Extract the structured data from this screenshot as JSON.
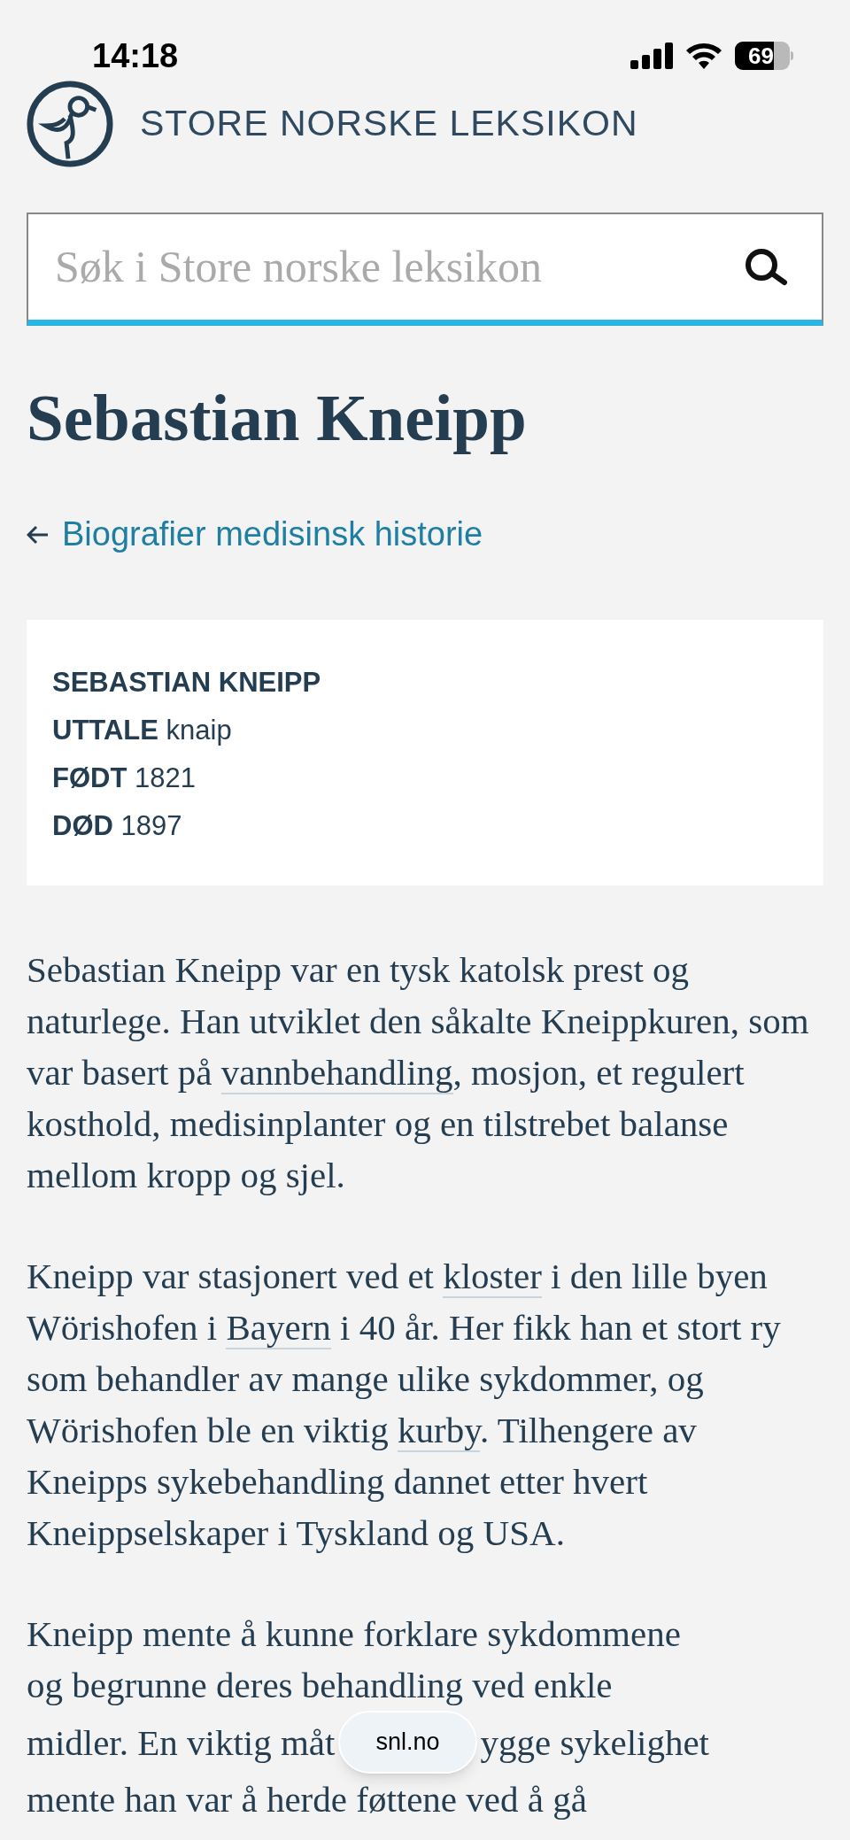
{
  "status_bar": {
    "time": "14:18",
    "battery": "69"
  },
  "header": {
    "site_name": "STORE NORSKE LEKSIKON"
  },
  "search": {
    "placeholder": "Søk i Store norske leksikon"
  },
  "article": {
    "title": "Sebastian Kneipp",
    "back_link": "Biografier medisinsk historie",
    "infobox": [
      {
        "label": "SEBASTIAN KNEIPP"
      },
      {
        "label": "UTTALE",
        "value": "knaip"
      },
      {
        "label": "FØDT",
        "value": "1821"
      },
      {
        "label": "DØD",
        "value": "1897"
      }
    ],
    "paragraphs": [
      {
        "segments": [
          {
            "text": "Sebastian Kneipp var en tysk katolsk prest og naturlege. Han utviklet den såkalte Kneippkuren, som var basert på ",
            "link": false
          },
          {
            "text": "vannbehandling",
            "link": true
          },
          {
            "text": ", mosjon, et regulert kosthold, medisinplanter og en tilstrebet balanse mellom kropp og sjel.",
            "link": false
          }
        ]
      },
      {
        "segments": [
          {
            "text": "Kneipp var stasjonert ved et ",
            "link": false
          },
          {
            "text": "kloster",
            "link": true
          },
          {
            "text": " i den lille byen Wörishofen i ",
            "link": false
          },
          {
            "text": "Bayern",
            "link": true
          },
          {
            "text": " i 40 år. Her fikk han et stort ry som behandler av mange ulike sykdommer, og Wörishofen ble en viktig ",
            "link": false
          },
          {
            "text": "kurby",
            "link": true
          },
          {
            "text": ". Tilhengere av Kneipps sykebehandling dannet etter hvert Kneippselskaper i Tyskland og USA.",
            "link": false
          }
        ]
      }
    ],
    "last_paragraph": {
      "lines": [
        "Kneipp mente å kunne forklare sykdommene",
        "og begrunne deres behandling ved enkle"
      ],
      "before_overlay": "midler. En viktig måt",
      "after_overlay": "ygge sykelighet",
      "last_line": "mente han var å herde føttene ved å gå"
    }
  },
  "address_pill": {
    "label": "snl.no"
  }
}
